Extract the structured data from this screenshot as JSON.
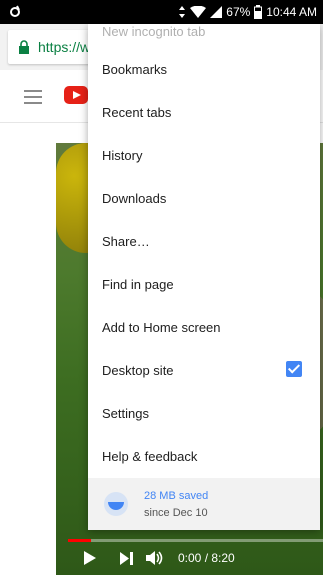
{
  "status_bar": {
    "battery": "67%",
    "time": "10:44 AM"
  },
  "browser": {
    "url_text": "https://w"
  },
  "video": {
    "time": "0:00 / 8:20",
    "progress": 0.09
  },
  "menu": {
    "items": [
      "New incognito tab",
      "Bookmarks",
      "Recent tabs",
      "History",
      "Downloads",
      "Share…",
      "Find in page",
      "Add to Home screen",
      "Desktop site",
      "Settings",
      "Help & feedback"
    ],
    "desktop_site_checked": true,
    "footer": {
      "saved": "28 MB saved",
      "since": "since Dec 10"
    }
  },
  "colors": {
    "accent": "#4285f4",
    "youtube_red": "#e62117",
    "url_green": "#0b8043"
  }
}
